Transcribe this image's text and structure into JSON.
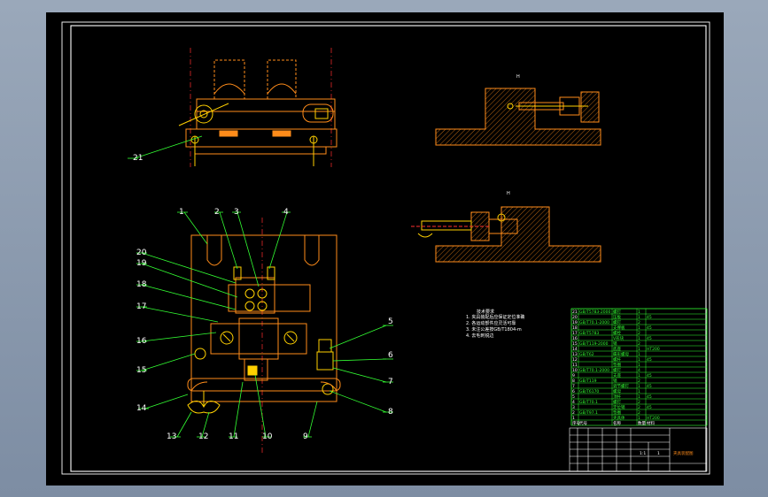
{
  "colors": {
    "background": "#000000",
    "frame": "#ffffff",
    "part": "#ff8c1a",
    "leader": "#33ff33",
    "hidden": "#ff3030",
    "bolt": "#ffd000"
  },
  "views": {
    "top_section_label": "H",
    "side_section_label": "H"
  },
  "balloons": [
    "1",
    "2",
    "3",
    "4",
    "5",
    "6",
    "7",
    "8",
    "9",
    "10",
    "11",
    "12",
    "13",
    "14",
    "15",
    "16",
    "17",
    "18",
    "19",
    "20",
    "21"
  ],
  "notes": {
    "title": "技术要求",
    "items": [
      "1. 夹具装配后应保证定位准确",
      "2. 各运动部件应灵活可靠",
      "3. 未注公差按GB/T1804-m",
      "4. 去毛刺锐边"
    ]
  },
  "bom": {
    "rows": [
      [
        "21",
        "GB/T5783-2000",
        "螺钉",
        "1",
        ""
      ],
      [
        "20",
        "",
        "压板",
        "1",
        "45"
      ],
      [
        "19",
        "GB/T70.1-2000",
        "螺钉",
        "2",
        ""
      ],
      [
        "18",
        "",
        "支撑板",
        "1",
        "45"
      ],
      [
        "17",
        "GB/T5783",
        "螺栓",
        "2",
        ""
      ],
      [
        "16",
        "",
        "V形块",
        "1",
        "45"
      ],
      [
        "15",
        "GB/T119-2000",
        "销",
        "2",
        ""
      ],
      [
        "14",
        "",
        "底座",
        "1",
        "HT200"
      ],
      [
        "13",
        "GB/T62",
        "蝶形螺母",
        "1",
        ""
      ],
      [
        "12",
        "",
        "螺杆",
        "1",
        "45"
      ],
      [
        "11",
        "",
        "垫圈",
        "1",
        ""
      ],
      [
        "10",
        "GB/T70.1-2000",
        "螺钉",
        "4",
        ""
      ],
      [
        "9",
        "",
        "支座",
        "1",
        "45"
      ],
      [
        "8",
        "GB/T119",
        "销",
        "2",
        ""
      ],
      [
        "7",
        "",
        "调节螺钉",
        "1",
        "45"
      ],
      [
        "6",
        "GB/T6170",
        "螺母",
        "1",
        ""
      ],
      [
        "5",
        "",
        "顶杆",
        "1",
        "45"
      ],
      [
        "4",
        "GB/T70.1",
        "螺钉",
        "2",
        ""
      ],
      [
        "3",
        "",
        "定位销",
        "2",
        "45"
      ],
      [
        "2",
        "GB/T97.1",
        "垫圈",
        "2",
        ""
      ],
      [
        "1",
        "",
        "夹具体",
        "1",
        "HT200"
      ],
      [
        "序号",
        "代号",
        "名称",
        "数量",
        "材料"
      ]
    ]
  },
  "title_block": {
    "name": "夹具装配图",
    "scale": "1:1",
    "sheet": "1"
  }
}
